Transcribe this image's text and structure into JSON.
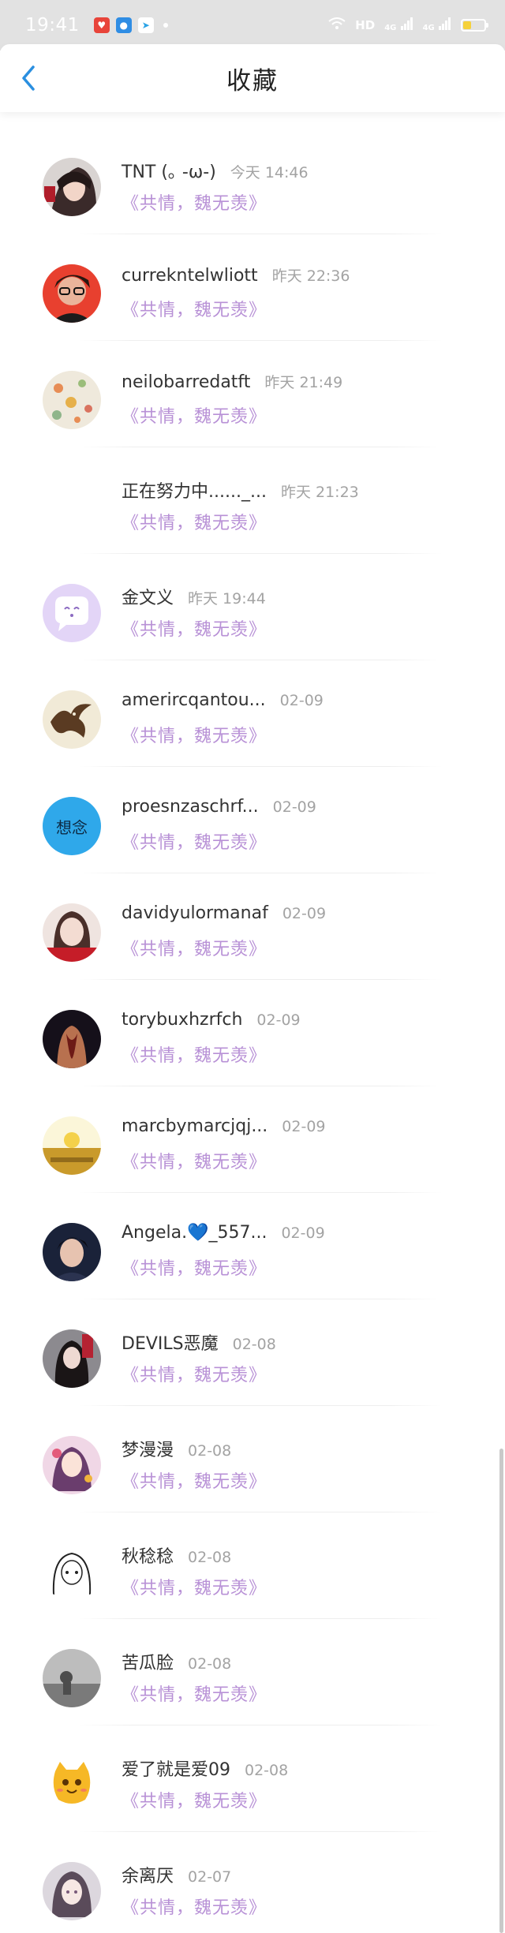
{
  "status": {
    "time": "19:41",
    "network": "HD",
    "signal1": "4G",
    "signal2": "4G"
  },
  "header": {
    "title": "收藏"
  },
  "items": [
    {
      "name": "TNT (｡ -ω-)",
      "time": "今天 14:46",
      "song": "《共情，魏无羡》"
    },
    {
      "name": "currekntelwliott",
      "time": "昨天 22:36",
      "song": "《共情，魏无羡》"
    },
    {
      "name": "neilobarredatft",
      "time": "昨天 21:49",
      "song": "《共情，魏无羡》"
    },
    {
      "name": "正在努力中......_...",
      "time": "昨天 21:23",
      "song": "《共情，魏无羡》"
    },
    {
      "name": "金文义",
      "time": "昨天 19:44",
      "song": "《共情，魏无羡》"
    },
    {
      "name": "amerircqantou...",
      "time": "02-09",
      "song": "《共情，魏无羡》"
    },
    {
      "name": "proesnzaschrf...",
      "time": "02-09",
      "song": "《共情，魏无羡》"
    },
    {
      "name": "davidyulormanaf",
      "time": "02-09",
      "song": "《共情，魏无羡》"
    },
    {
      "name": "torybuxhzrfch",
      "time": "02-09",
      "song": "《共情，魏无羡》"
    },
    {
      "name": "marcbymarcjqj...",
      "time": "02-09",
      "song": "《共情，魏无羡》"
    },
    {
      "name": "Angela.💙_557...",
      "time": "02-09",
      "song": "《共情，魏无羡》"
    },
    {
      "name": "DEVILS恶魔",
      "time": "02-08",
      "song": "《共情，魏无羡》"
    },
    {
      "name": "梦漫漫",
      "time": "02-08",
      "song": "《共情，魏无羡》"
    },
    {
      "name": "秋稔稔",
      "time": "02-08",
      "song": "《共情，魏无羡》"
    },
    {
      "name": "苦瓜脸",
      "time": "02-08",
      "song": "《共情，魏无羡》"
    },
    {
      "name": "爱了就是爱09",
      "time": "02-08",
      "song": "《共情，魏无羡》"
    },
    {
      "name": "余离厌",
      "time": "02-07",
      "song": "《共情，魏无羡》"
    }
  ],
  "avatar_art": [
    "anime-girl-dark",
    "woman-glasses-red",
    "floral-pattern",
    "empty",
    "purple-chat-bubble",
    "phoenix-bird",
    "blue-text-xiangnian",
    "boy-red-banner",
    "back-tattoo",
    "golden-field",
    "boy-blue-night",
    "dark-hair-figure",
    "anime-colorful",
    "anime-sketch",
    "gray-photo",
    "yellow-cat",
    "anime-girl-pale"
  ],
  "avatar_text": {
    "6": "想念"
  },
  "colors": {
    "accent_blue": "#2a8fe0",
    "song_purple": "#b891d6",
    "time_gray": "#a3a3a3",
    "status_gray": "#e2e2e2"
  }
}
